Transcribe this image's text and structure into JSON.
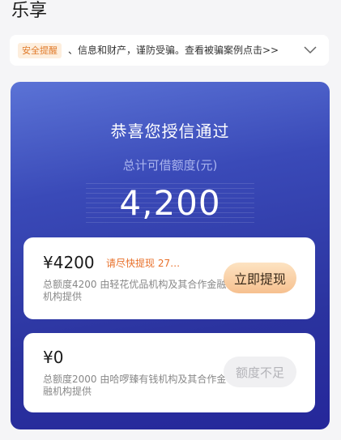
{
  "page": {
    "title": "乐享"
  },
  "notice": {
    "badge": "安全提醒",
    "text": "、信息和财产，谨防受骗。查看被骗案例点击>>",
    "expand_icon": "chevron-down-icon"
  },
  "credit_card": {
    "congrats": "恭喜您授信通过",
    "total_label": "总计可借额度(元)",
    "total_amount": "4,200",
    "gradient_start": "#5b73d6",
    "gradient_end": "#25279a"
  },
  "loans": [
    {
      "amount": "¥4200",
      "urgent_text": "请尽快提现 27…",
      "description": "总额度4200 由轻花优品机构及其合作金融机构提供",
      "action_label": "立即提现",
      "action_enabled": true
    },
    {
      "amount": "¥0",
      "description": "总额度2000 由哈啰臻有钱机构及其合作金融机构提供",
      "action_label": "额度不足",
      "action_enabled": false
    }
  ],
  "colors": {
    "accent_orange": "#e8702a",
    "button_gold": "#f6c08f",
    "disabled_gray": "#b3b3b8"
  }
}
